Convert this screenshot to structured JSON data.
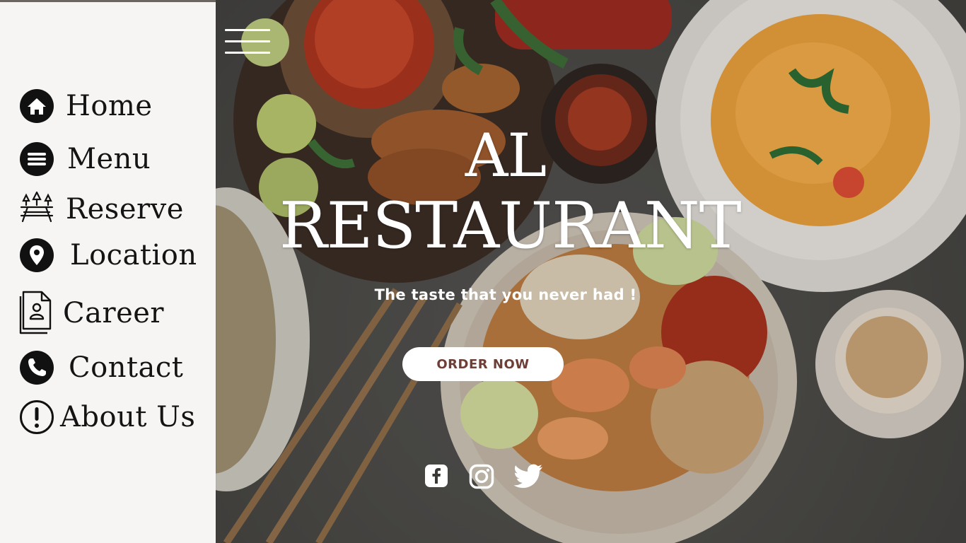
{
  "nav": {
    "items": [
      {
        "label": "Home",
        "icon": "home-icon"
      },
      {
        "label": "Menu",
        "icon": "menu-circle-icon"
      },
      {
        "label": "Reserve",
        "icon": "picnic-table-icon"
      },
      {
        "label": "Location",
        "icon": "location-pin-icon"
      },
      {
        "label": "Career",
        "icon": "resume-document-icon"
      },
      {
        "label": "Contact",
        "icon": "phone-icon"
      },
      {
        "label": "About Us",
        "icon": "exclamation-circle-icon"
      }
    ]
  },
  "hero": {
    "title_line1": "AL",
    "title_line2": "RESTAURANT",
    "tagline": "The taste that you never had !",
    "order_button": "ORDER NOW"
  },
  "social": [
    "facebook-icon",
    "instagram-icon",
    "twitter-icon"
  ],
  "colors": {
    "sidebar_bg": "#f7f5f3",
    "button_text": "#6e3f36",
    "text_light": "#ffffff",
    "nav_text": "#141414"
  }
}
